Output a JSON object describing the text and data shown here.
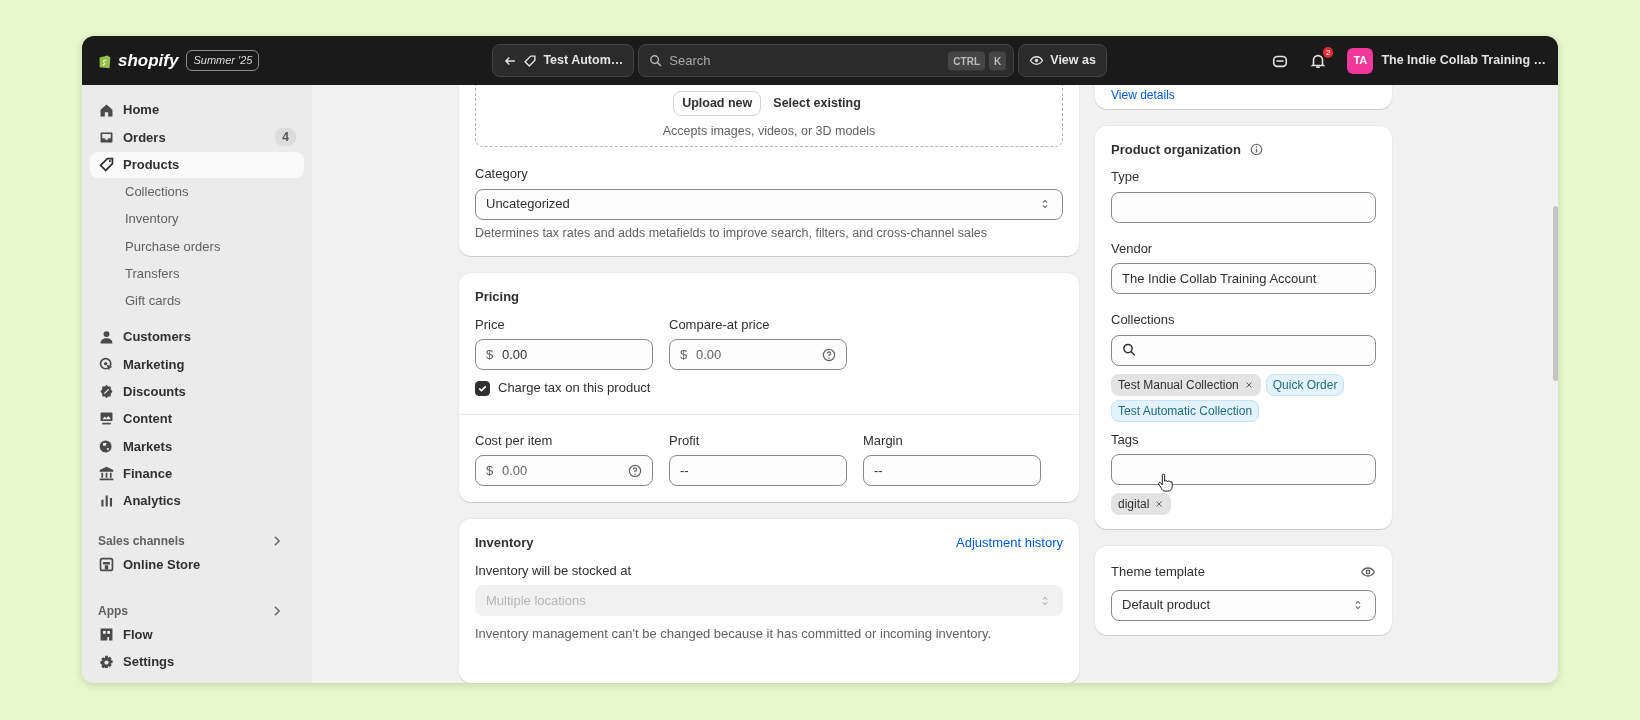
{
  "topbar": {
    "logo": "shopify",
    "edition": "Summer '25",
    "breadcrumb": "Test Autom…",
    "search": {
      "placeholder": "Search",
      "keys": [
        "CTRL",
        "K"
      ]
    },
    "view_as": "View as",
    "notifications": "2",
    "avatar": "TA",
    "store": "The Indie Collab Training …"
  },
  "sidebar": {
    "groups": [
      {
        "items": [
          {
            "label": "Home",
            "kind": "main",
            "selected": false
          },
          {
            "label": "Orders",
            "kind": "main",
            "selected": false,
            "badge": "4"
          },
          {
            "label": "Products",
            "kind": "main",
            "selected": true
          },
          {
            "label": "Collections",
            "kind": "sub",
            "selected": false
          },
          {
            "label": "Inventory",
            "kind": "sub",
            "selected": false
          },
          {
            "label": "Purchase orders",
            "kind": "sub",
            "selected": false
          },
          {
            "label": "Transfers",
            "kind": "sub",
            "selected": false
          },
          {
            "label": "Gift cards",
            "kind": "sub",
            "selected": false
          },
          {
            "label": "Customers",
            "kind": "main",
            "selected": false
          },
          {
            "label": "Marketing",
            "kind": "main",
            "selected": false
          },
          {
            "label": "Discounts",
            "kind": "main",
            "selected": false
          },
          {
            "label": "Content",
            "kind": "main",
            "selected": false
          },
          {
            "label": "Markets",
            "kind": "main",
            "selected": false
          },
          {
            "label": "Finance",
            "kind": "main",
            "selected": false
          },
          {
            "label": "Analytics",
            "kind": "main",
            "selected": false
          }
        ]
      },
      {
        "heading": "Sales channels",
        "items": [
          {
            "label": "Online Store",
            "kind": "main",
            "selected": false
          }
        ]
      },
      {
        "heading": "Apps",
        "items": [
          {
            "label": "Flow",
            "kind": "main",
            "selected": false
          },
          {
            "label": "Settings",
            "kind": "main",
            "selected": false
          }
        ]
      }
    ]
  },
  "media": {
    "buttons": [
      "Upload new",
      "Select existing"
    ],
    "hint": "Accepts images, videos, or 3D models"
  },
  "category": {
    "label": "Category",
    "value": "Uncategorized",
    "help": "Determines tax rates and adds metafields to improve search, filters, and cross-channel sales"
  },
  "pricing": {
    "title": "Pricing",
    "fields": [
      {
        "label": "Price",
        "prefix": "$",
        "value": "0.00",
        "help_icon": false
      },
      {
        "label": "Compare-at price",
        "prefix": "$",
        "placeholder": "0.00",
        "help_icon": true
      }
    ],
    "charge_tax": {
      "label": "Charge tax on this product",
      "checked": true
    },
    "cost_fields": [
      {
        "label": "Cost per item",
        "prefix": "$",
        "placeholder": "0.00",
        "help_icon": true
      },
      {
        "label": "Profit",
        "value": "--",
        "help_icon": false
      },
      {
        "label": "Margin",
        "value": "--",
        "help_icon": false
      }
    ]
  },
  "inventory": {
    "title": "Inventory",
    "link": "Adjustment history",
    "label": "Inventory will be stocked at",
    "select": {
      "value": "Multiple locations",
      "disabled": true
    },
    "note": "Inventory management can't be changed because it has committed or incoming inventory."
  },
  "details_link": "View details",
  "organization": {
    "title": "Product organization",
    "type": {
      "label": "Type"
    },
    "vendor": {
      "label": "Vendor",
      "value": "The Indie Collab Training Account"
    },
    "collections": {
      "label": "Collections",
      "chips": [
        {
          "label": "Test Manual Collection",
          "removable": true,
          "color": "#e3e3e3"
        },
        {
          "label": "Quick Order",
          "removable": false,
          "color": "#e4f2fb"
        },
        {
          "label": "Test Automatic Collection",
          "removable": false,
          "color": "#e4f2fb"
        }
      ]
    },
    "tags": {
      "label": "Tags",
      "chips": [
        {
          "label": "digital",
          "removable": true,
          "color": "#e3e3e3"
        }
      ]
    }
  },
  "theme": {
    "label": "Theme template",
    "value": "Default product"
  }
}
